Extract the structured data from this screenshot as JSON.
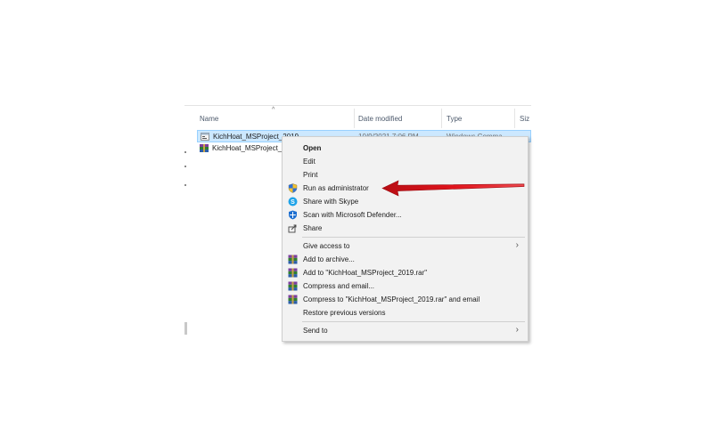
{
  "explorer": {
    "columns": {
      "name": "Name",
      "date_modified": "Date modified",
      "type": "Type",
      "size": "Siz"
    },
    "files": [
      {
        "name": "KichHoat_MSProject_2019",
        "date": "10/9/2021 7:06 PM",
        "type": "Windows Comma...",
        "icon": "batch-file-icon",
        "selected": true
      },
      {
        "name": "KichHoat_MSProject_",
        "date": "",
        "type": "",
        "icon": "winrar-archive-icon",
        "selected": false
      }
    ]
  },
  "context_menu": {
    "items": [
      {
        "label": "Open",
        "bold": true,
        "icon": ""
      },
      {
        "label": "Edit",
        "icon": ""
      },
      {
        "label": "Print",
        "icon": ""
      },
      {
        "label": "Run as administrator",
        "icon": "uac-shield-icon"
      },
      {
        "label": "Share with Skype",
        "icon": "skype-icon"
      },
      {
        "label": "Scan with Microsoft Defender...",
        "icon": "defender-icon"
      },
      {
        "label": "Share",
        "icon": "share-icon"
      },
      {
        "label": "Give access to",
        "icon": "",
        "submenu": true
      },
      {
        "label": "Add to archive...",
        "icon": "winrar-icon"
      },
      {
        "label": "Add to \"KichHoat_MSProject_2019.rar\"",
        "icon": "winrar-icon"
      },
      {
        "label": "Compress and email...",
        "icon": "winrar-icon"
      },
      {
        "label": "Compress to \"KichHoat_MSProject_2019.rar\" and email",
        "icon": "winrar-icon"
      },
      {
        "label": "Restore previous versions",
        "icon": ""
      },
      {
        "label": "Send to",
        "icon": "",
        "submenu": true
      }
    ],
    "submenu_glyph": "›"
  },
  "annotation": {
    "arrow_color": "#e0141c",
    "points_to": "Run as administrator"
  },
  "colors": {
    "selection_bg": "#cce8ff",
    "selection_border": "#99d1ff",
    "menu_bg": "#f2f2f2",
    "header_text": "#4d5a6c"
  }
}
